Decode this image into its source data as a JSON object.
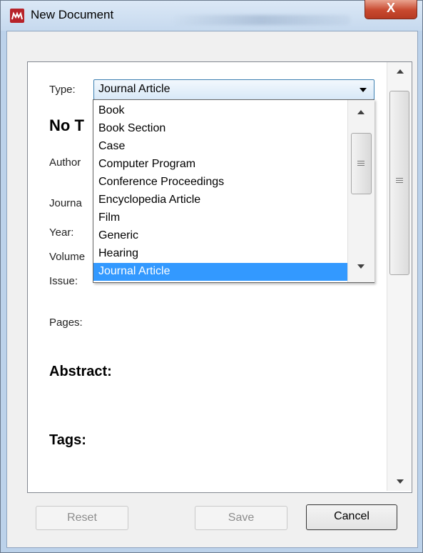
{
  "window": {
    "title": "New Document",
    "icon": "mendeley-icon",
    "close_label": "X"
  },
  "form": {
    "type_label": "Type:",
    "type_value": "Journal Article",
    "title_partial": "No T",
    "fields": [
      "Author",
      "Journa",
      "Year:",
      "Volume",
      "Issue:",
      "Pages:"
    ],
    "sections": [
      "Abstract:",
      "Tags:"
    ]
  },
  "dropdown": {
    "options": [
      "Book",
      "Book Section",
      "Case",
      "Computer Program",
      "Conference Proceedings",
      "Encyclopedia Article",
      "Film",
      "Generic",
      "Hearing",
      "Journal Article"
    ],
    "selected": "Journal Article"
  },
  "buttons": {
    "reset": "Reset",
    "save": "Save",
    "cancel": "Cancel"
  },
  "colors": {
    "selection": "#3399ff",
    "app_icon": "#b7232a",
    "close_button": "#c8492f"
  }
}
